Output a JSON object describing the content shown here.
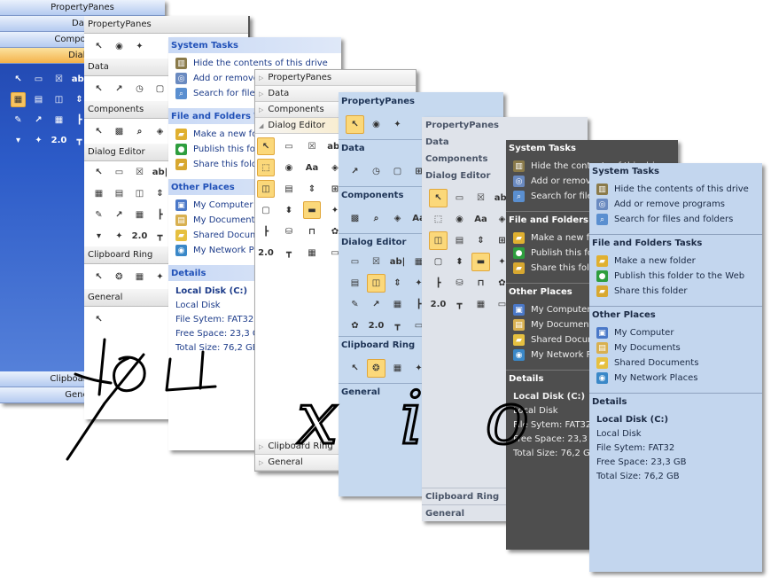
{
  "toolbox_vs2003": {
    "top_headers": [
      "PropertyPanes",
      "Data",
      "Components"
    ],
    "open_section": {
      "title": "Dialog",
      "icons": [
        "pointer",
        "button",
        "checkbox",
        "textbox",
        "picture",
        "image-list",
        "spin",
        "vertical-spin",
        "edit-list",
        "chart",
        "grid",
        "tree",
        "combo",
        "component",
        "ip-address",
        "slider"
      ],
      "selected": [
        4
      ]
    },
    "bottom_headers": [
      "Clipboard Ring",
      "General"
    ]
  },
  "toolbox_vs2005": {
    "sections": [
      {
        "title": "PropertyPanes",
        "icons": [
          "pointer",
          "radio",
          "component"
        ],
        "selected": []
      },
      {
        "title": "Data",
        "icons": [
          "pointer",
          "chart",
          "timer",
          "dialog"
        ],
        "selected": []
      },
      {
        "title": "Components",
        "icons": [
          "pointer",
          "report",
          "query",
          "package"
        ],
        "selected": []
      },
      {
        "title": "Dialog Editor",
        "icons": [
          "pointer",
          "button",
          "checkbox",
          "textbox",
          "picture",
          "image-list",
          "spin",
          "vertical-spin",
          "edit-list",
          "chart",
          "grid",
          "tree",
          "combo",
          "component",
          "ip-address",
          "slider"
        ],
        "selected": []
      },
      {
        "title": "Clipboard Ring",
        "icons": [
          "pointer",
          "bug",
          "grid",
          "component"
        ],
        "selected": []
      },
      {
        "title": "General",
        "icons": [
          "pointer"
        ],
        "selected": []
      }
    ]
  },
  "toolbox_vs2008": {
    "top_headers": [
      "PropertyPanes",
      "Data",
      "Components"
    ],
    "open_section": {
      "title": "Dialog Editor",
      "icons": [
        "pointer",
        "button",
        "checkbox",
        "textbox",
        "groupbox",
        "radio",
        "label",
        "package",
        "spin",
        "image-list",
        "vertical-spin",
        "split",
        "dialog",
        "updown",
        "progress",
        "component",
        "tree",
        "database",
        "tab",
        "custom",
        "ip-address",
        "slider",
        "grid",
        "hotkey"
      ],
      "selected": [
        0,
        4,
        8,
        14
      ]
    },
    "bottom_headers": [
      "Clipboard Ring",
      "General"
    ]
  },
  "toolbox_office": {
    "sections": [
      {
        "title": "PropertyPanes",
        "icons": [
          "pointer",
          "radio",
          "component"
        ],
        "selected": [
          0
        ]
      },
      {
        "title": "Data",
        "icons": [
          "chart",
          "timer",
          "dialog",
          "split"
        ],
        "selected": []
      },
      {
        "title": "Components",
        "icons": [
          "report",
          "query",
          "package",
          "label"
        ],
        "selected": []
      },
      {
        "title": "Dialog Editor",
        "icons": [
          "button",
          "checkbox",
          "textbox",
          "picture",
          "image-list",
          "spin",
          "vertical-spin",
          "component",
          "edit-list",
          "chart",
          "grid",
          "tree",
          "custom",
          "ip-address",
          "slider",
          "hotkey"
        ],
        "selected": [
          5
        ]
      },
      {
        "title": "Clipboard Ring",
        "icons": [
          "pointer",
          "bug",
          "grid",
          "component"
        ],
        "selected": [
          1
        ]
      },
      {
        "title": "General",
        "icons": [],
        "selected": []
      }
    ]
  },
  "toolbox_flat": {
    "top_headers": [
      "PropertyPanes",
      "Data",
      "Components"
    ],
    "open_section": {
      "title": "Dialog Editor",
      "icons": [
        "pointer",
        "button",
        "checkbox",
        "textbox",
        "groupbox",
        "radio",
        "label",
        "package",
        "spin",
        "image-list",
        "vertical-spin",
        "split",
        "dialog",
        "updown",
        "progress",
        "component",
        "tree",
        "database",
        "tab",
        "custom",
        "ip-address",
        "slider",
        "grid",
        "hotkey"
      ],
      "selected": [
        0,
        8,
        14
      ]
    },
    "bottom_headers": [
      "Clipboard Ring",
      "General"
    ]
  },
  "task_pane": {
    "sections": [
      {
        "title": "System Tasks",
        "items": [
          {
            "label": "Hide the contents of this drive",
            "icon": "hide-drive"
          },
          {
            "label": "Add or remove programs",
            "icon": "add-remove-programs"
          },
          {
            "label": "Search for files and folders",
            "icon": "search"
          }
        ]
      },
      {
        "title": "File and Folders Tasks",
        "items": [
          {
            "label": "Make a new folder",
            "icon": "new-folder"
          },
          {
            "label": "Publish this folder to the Web",
            "icon": "publish-web"
          },
          {
            "label": "Share this folder",
            "icon": "share-folder"
          }
        ]
      },
      {
        "title": "Other Places",
        "items": [
          {
            "label": "My Computer",
            "icon": "my-computer"
          },
          {
            "label": "My Documents",
            "icon": "my-documents"
          },
          {
            "label": "Shared Documents",
            "icon": "shared-documents"
          },
          {
            "label": "My Network Places",
            "icon": "network-places"
          }
        ]
      }
    ],
    "details": {
      "title": "Details",
      "name": "Local Disk (C:)",
      "type": "Local Disk",
      "file_system": "File Sytem: FAT32",
      "free_space": "Free Space: 23,3 GB",
      "total_size": "Total Size: 76,2 GB"
    }
  },
  "handwriting": [
    "you",
    "x i o"
  ],
  "colors": {
    "selected_icon": "#fbd87a",
    "xp_header_text": "#2151b8",
    "office_blue": "#c6d9ef",
    "dark_pane": "#4e4e4e"
  }
}
